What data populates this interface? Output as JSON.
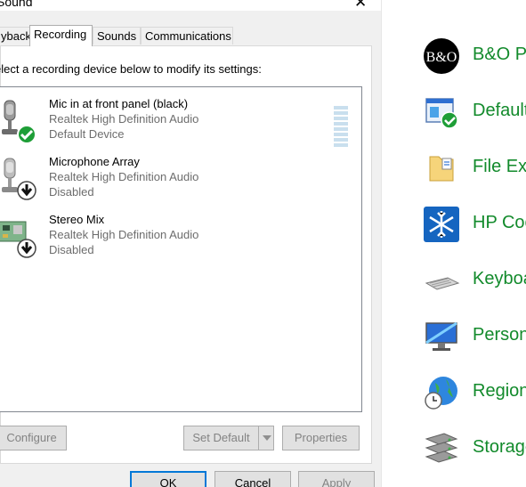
{
  "dialog": {
    "title": "Sound",
    "close_glyph": "✕",
    "tabs": [
      {
        "label": "Playback",
        "visible_label": "yback"
      },
      {
        "label": "Recording"
      },
      {
        "label": "Sounds"
      },
      {
        "label": "Communications"
      }
    ],
    "instruction": "elect a recording device below to modify its settings:",
    "devices": [
      {
        "name": "Mic in at front panel (black)",
        "driver": "Realtek High Definition Audio",
        "status": "Default Device",
        "icon": "microphone-icon",
        "badge": "green-check-badge"
      },
      {
        "name": "Microphone Array",
        "driver": "Realtek High Definition Audio",
        "status": "Disabled",
        "icon": "microphone-icon",
        "badge": "disabled-arrow-badge"
      },
      {
        "name": "Stereo Mix",
        "driver": "Realtek High Definition Audio",
        "status": "Disabled",
        "icon": "circuit-board-icon",
        "badge": "disabled-arrow-badge"
      }
    ],
    "buttons": {
      "configure": "Configure",
      "set_default": "Set Default",
      "properties": "Properties",
      "ok": "OK",
      "cancel": "Cancel",
      "apply": "Apply"
    }
  },
  "control_panel": {
    "items": [
      {
        "label": "B&O P",
        "icon": "bang-olufsen-icon"
      },
      {
        "label": "Default",
        "icon": "default-programs-icon"
      },
      {
        "label": "File Exp",
        "icon": "folder-options-icon"
      },
      {
        "label": "HP Coo",
        "icon": "snowflake-icon"
      },
      {
        "label": "Keyboa",
        "icon": "keyboard-icon"
      },
      {
        "label": "Persona",
        "icon": "monitor-icon"
      },
      {
        "label": "Region",
        "icon": "globe-clock-icon"
      },
      {
        "label": "Storage",
        "icon": "storage-drives-icon"
      }
    ],
    "label_color": "#128a2b"
  }
}
